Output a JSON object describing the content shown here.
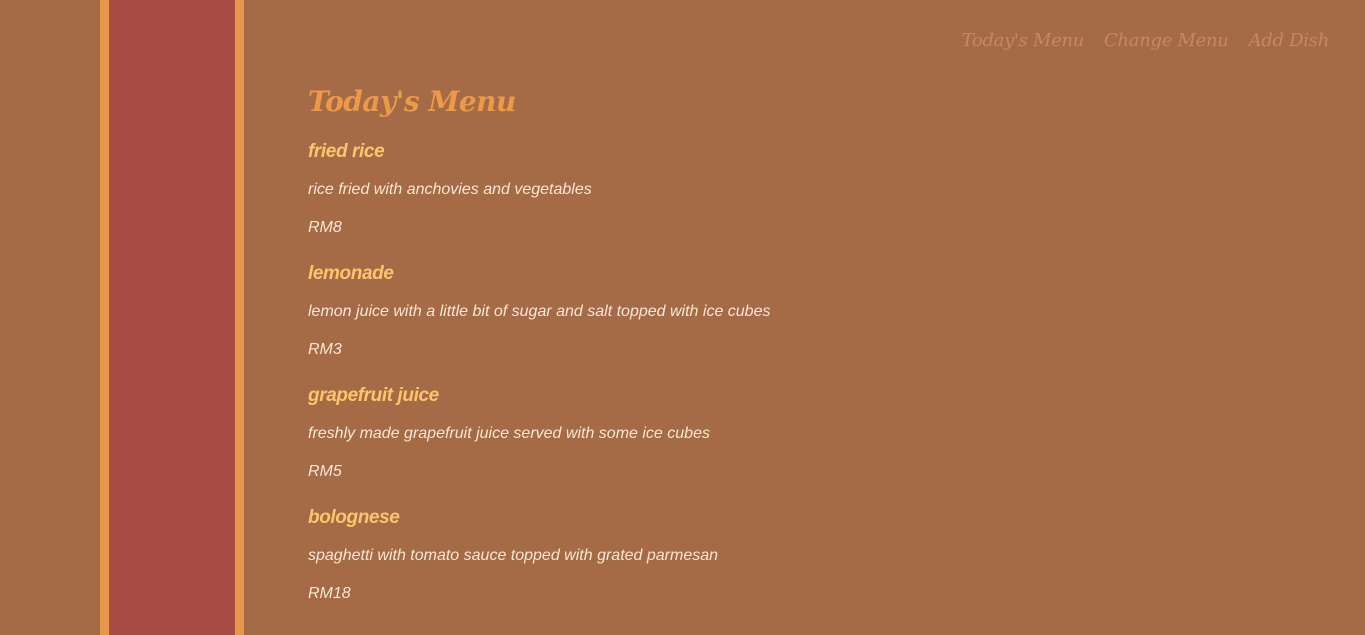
{
  "nav": {
    "items": [
      {
        "label": "Today's Menu"
      },
      {
        "label": "Change Menu"
      },
      {
        "label": "Add Dish"
      }
    ]
  },
  "main": {
    "title": "Today's Menu",
    "dishes": [
      {
        "name": "fried rice",
        "description": "rice fried with anchovies and vegetables",
        "price": "RM8"
      },
      {
        "name": "lemonade",
        "description": "lemon juice with a little bit of sugar and salt topped with ice cubes",
        "price": "RM3"
      },
      {
        "name": "grapefruit juice",
        "description": "freshly made grapefruit juice served with some ice cubes",
        "price": "RM5"
      },
      {
        "name": "bolognese",
        "description": "spaghetti with tomato sauce topped with grated parmesan",
        "price": "RM18"
      }
    ]
  },
  "colors": {
    "background": "#a56b46",
    "accent_orange": "#e8964a",
    "accent_red": "#aa4a44",
    "dish_name": "#ffc46b",
    "text": "#f6e6d3"
  }
}
